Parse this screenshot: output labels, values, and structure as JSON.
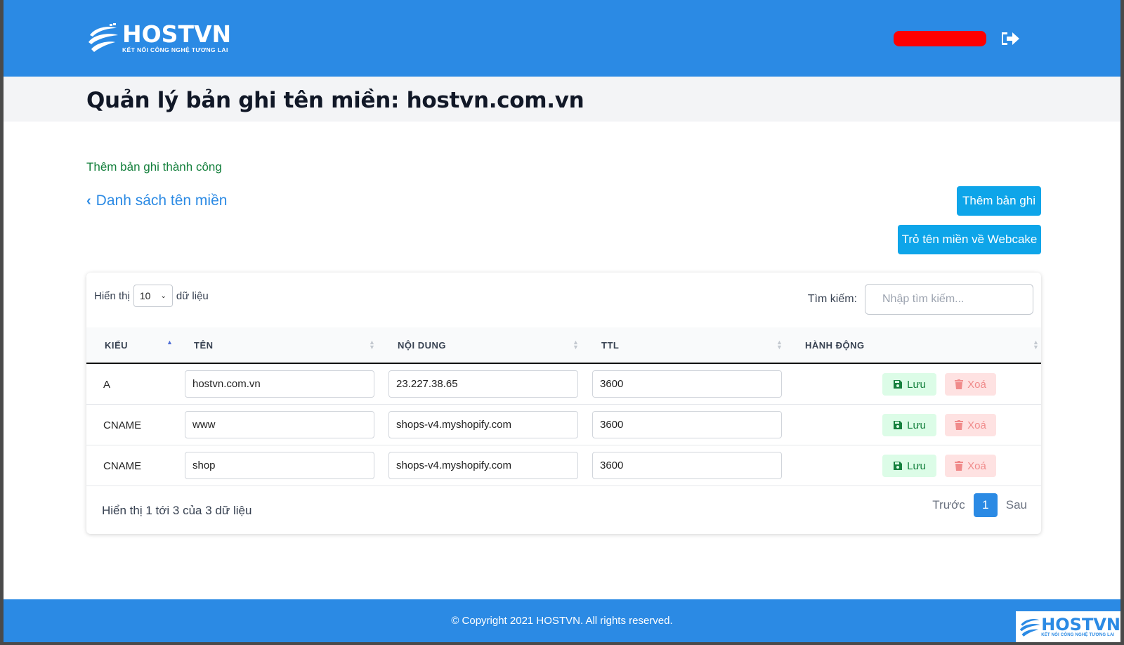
{
  "header": {
    "brand_name": "HOSTVN",
    "brand_tagline": "KẾT NỐI CÔNG NGHỆ TƯƠNG LAI",
    "logout_icon": "sign-out-icon"
  },
  "page": {
    "title": "Quản lý bản ghi tên miền: hostvn.com.vn",
    "alert": "Thêm bản ghi thành công",
    "back_label": "Danh sách tên miền",
    "add_button": "Thêm bản ghi",
    "webcake_button": "Trỏ tên miền về Webcake"
  },
  "table_controls": {
    "show_label": "Hiển thị",
    "page_length": "10",
    "records_label": "dữ liệu",
    "search_label": "Tìm kiếm:",
    "search_placeholder": "Nhập tìm kiếm...",
    "search_value": ""
  },
  "columns": [
    "KIỂU",
    "TÊN",
    "NỘI DUNG",
    "TTL",
    "HÀNH ĐỘNG"
  ],
  "rows": [
    {
      "type": "A",
      "name": "hostvn.com.vn",
      "content": "23.227.38.65",
      "ttl": "3600"
    },
    {
      "type": "CNAME",
      "name": "www",
      "content": "shops-v4.myshopify.com",
      "ttl": "3600"
    },
    {
      "type": "CNAME",
      "name": "shop",
      "content": "shops-v4.myshopify.com",
      "ttl": "3600"
    }
  ],
  "actions": {
    "save": "Lưu",
    "delete": "Xoá"
  },
  "table_footer": {
    "info": "Hiển thị 1 tới 3 của 3 dữ liệu",
    "prev": "Trước",
    "current_page": "1",
    "next": "Sau"
  },
  "footer": {
    "copyright": "© Copyright 2021 HOSTVN. All rights reserved.",
    "brand_name": "HOSTVN",
    "brand_tagline": "KẾT NỐI CÔNG NGHỆ TƯƠNG LAI"
  },
  "colors": {
    "primary": "#2b8ae4",
    "button_info": "#0ea5e9",
    "success_text": "#15803d",
    "save_bg": "#dcfce7",
    "delete_bg": "#fee2e2",
    "redaction": "#ff0000"
  }
}
